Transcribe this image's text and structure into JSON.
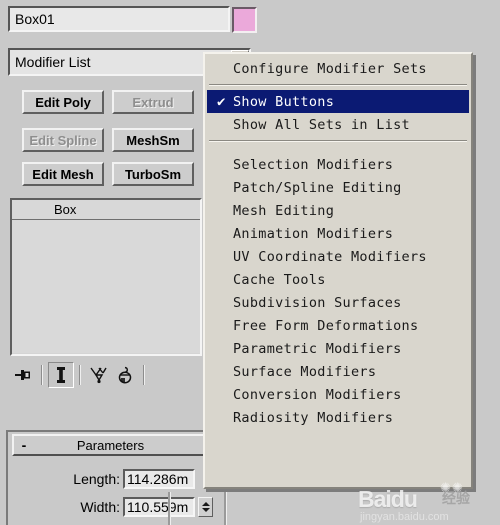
{
  "object": {
    "name_value": "Box01",
    "color_swatch": "#eba9da"
  },
  "modifier_list": {
    "label": "Modifier List",
    "arrow_icon": "chevron-down-icon"
  },
  "modifier_buttons": [
    {
      "label": "Edit Poly",
      "disabled": false
    },
    {
      "label": "Extrud",
      "disabled": true
    },
    {
      "label": "Edit Spline",
      "disabled": true
    },
    {
      "label": "MeshSm",
      "disabled": false
    },
    {
      "label": "Edit Mesh",
      "disabled": false
    },
    {
      "label": "TurboSm",
      "disabled": false
    }
  ],
  "modifier_stack": {
    "entries": [
      "Box"
    ]
  },
  "stack_toolbar": {
    "items": [
      {
        "icon": "pin-stack-icon",
        "pressed": false
      },
      {
        "icon": "show-end-result-icon",
        "pressed": true
      },
      {
        "icon": "make-unique-icon",
        "pressed": false
      },
      {
        "icon": "remove-modifier-icon",
        "pressed": false
      }
    ]
  },
  "parameters": {
    "rollout_title": "Parameters",
    "collapse_glyph": "-",
    "rows": [
      {
        "label": "Length:",
        "value": "114.286m"
      },
      {
        "label": "Width:",
        "value": "110.559m"
      }
    ]
  },
  "context_menu": {
    "items": [
      {
        "label": "Configure Modifier Sets",
        "type": "item",
        "checked": false,
        "highlight": false
      },
      {
        "label": "",
        "type": "separator"
      },
      {
        "label": "Show Buttons",
        "type": "item",
        "checked": true,
        "highlight": true
      },
      {
        "label": "Show All Sets in List",
        "type": "item",
        "checked": false,
        "highlight": false
      },
      {
        "label": "",
        "type": "separator"
      },
      {
        "label": "Selection Modifiers",
        "type": "item",
        "checked": false,
        "highlight": false
      },
      {
        "label": "Patch/Spline Editing",
        "type": "item",
        "checked": false,
        "highlight": false
      },
      {
        "label": "Mesh Editing",
        "type": "item",
        "checked": false,
        "highlight": false
      },
      {
        "label": "Animation Modifiers",
        "type": "item",
        "checked": false,
        "highlight": false
      },
      {
        "label": "UV Coordinate Modifiers",
        "type": "item",
        "checked": false,
        "highlight": false
      },
      {
        "label": "Cache Tools",
        "type": "item",
        "checked": false,
        "highlight": false
      },
      {
        "label": "Subdivision Surfaces",
        "type": "item",
        "checked": false,
        "highlight": false
      },
      {
        "label": "Free Form Deformations",
        "type": "item",
        "checked": false,
        "highlight": false
      },
      {
        "label": "Parametric Modifiers",
        "type": "item",
        "checked": false,
        "highlight": false
      },
      {
        "label": "Surface Modifiers",
        "type": "item",
        "checked": false,
        "highlight": false
      },
      {
        "label": "Conversion Modifiers",
        "type": "item",
        "checked": false,
        "highlight": false
      },
      {
        "label": "Radiosity Modifiers",
        "type": "item",
        "checked": false,
        "highlight": false
      }
    ],
    "check_glyph": "✔",
    "highlight_color": "#0b1a73"
  },
  "watermark": {
    "brand": "Baidu",
    "brand_cn": "经验",
    "url": "jingyan.baidu.com",
    "paws": "✺✺"
  }
}
